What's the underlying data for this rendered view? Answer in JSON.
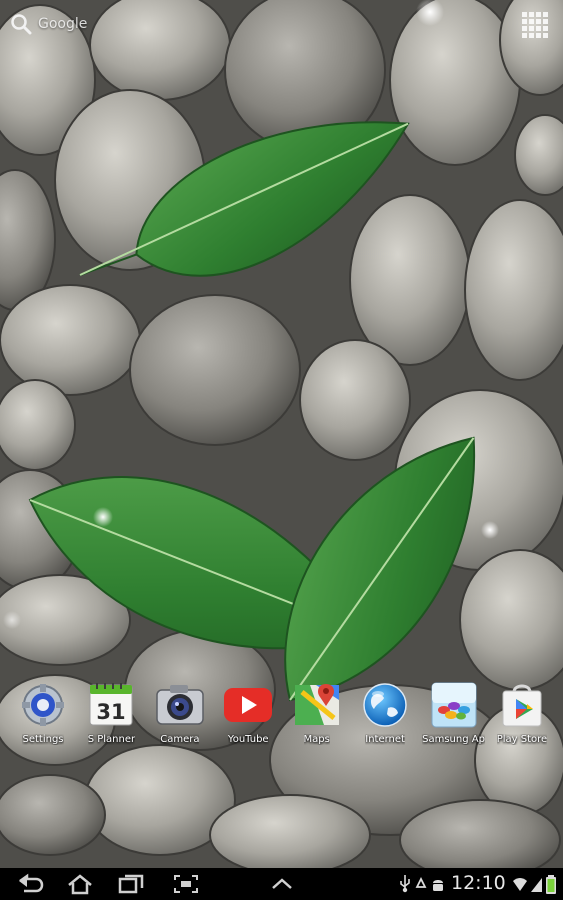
{
  "search": {
    "label": "Google"
  },
  "dock": {
    "apps": [
      {
        "label": "Settings",
        "icon": "settings-gear-icon"
      },
      {
        "label": "S Planner",
        "icon": "calendar-icon",
        "day": "31"
      },
      {
        "label": "Camera",
        "icon": "camera-icon"
      },
      {
        "label": "YouTube",
        "icon": "youtube-play-icon"
      },
      {
        "label": "Maps",
        "icon": "maps-pin-icon"
      },
      {
        "label": "Internet",
        "icon": "globe-icon"
      },
      {
        "label": "Samsung Ap",
        "icon": "samsung-apps-icon"
      },
      {
        "label": "Play Store",
        "icon": "play-store-bag-icon"
      }
    ]
  },
  "status_bar": {
    "time": "12:10"
  },
  "colors": {
    "navbar": "#000000",
    "leaf": "#3d8c3a",
    "stone": "#9c9a93",
    "youtube_red": "#e52d27",
    "play_green": "#34a853"
  }
}
